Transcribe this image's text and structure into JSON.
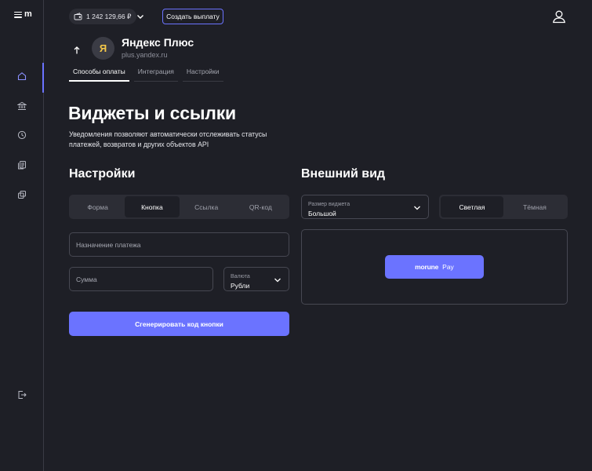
{
  "app": {
    "logo": "m"
  },
  "sidebar": {
    "items": [
      {
        "icon": "home-icon"
      },
      {
        "icon": "bank-icon"
      },
      {
        "icon": "history-icon"
      },
      {
        "icon": "documents-icon"
      },
      {
        "icon": "copy-icon"
      }
    ],
    "logout_icon": "logout-icon"
  },
  "topbar": {
    "balance": "1 242 129,66 ₽",
    "create_payout": "Создать выплату"
  },
  "merchant": {
    "avatar_letter": "Я",
    "name": "Яндекс Плюс",
    "url": "plus.yandex.ru"
  },
  "tabs": [
    {
      "label": "Способы оплаты",
      "active": true
    },
    {
      "label": "Интеграция",
      "active": false
    },
    {
      "label": "Настройки",
      "active": false
    }
  ],
  "page": {
    "title": "Виджеты и ссылки",
    "description": "Уведомления позволяют автоматически отслеживать статусы платежей, возвратов и других объектов API"
  },
  "settings": {
    "title": "Настройки",
    "segments": [
      "Форма",
      "Кнопка",
      "Ссылка",
      "QR-код"
    ],
    "active_segment": "Кнопка",
    "purpose_placeholder": "Назначение платежа",
    "amount_placeholder": "Сумма",
    "currency_label": "Валюта",
    "currency_value": "Рубли",
    "generate_button": "Сгенерировать код кнопки"
  },
  "appearance": {
    "title": "Внешний вид",
    "size_label": "Размер виджета",
    "size_value": "Большой",
    "themes": [
      "Светлая",
      "Тёмная"
    ],
    "active_theme": "Светлая",
    "preview_brand": "morune",
    "preview_pay": "Pay"
  },
  "colors": {
    "background": "#1e1f26",
    "accent": "#6b73ff",
    "surface": "#2c2d35",
    "border": "#474852"
  }
}
